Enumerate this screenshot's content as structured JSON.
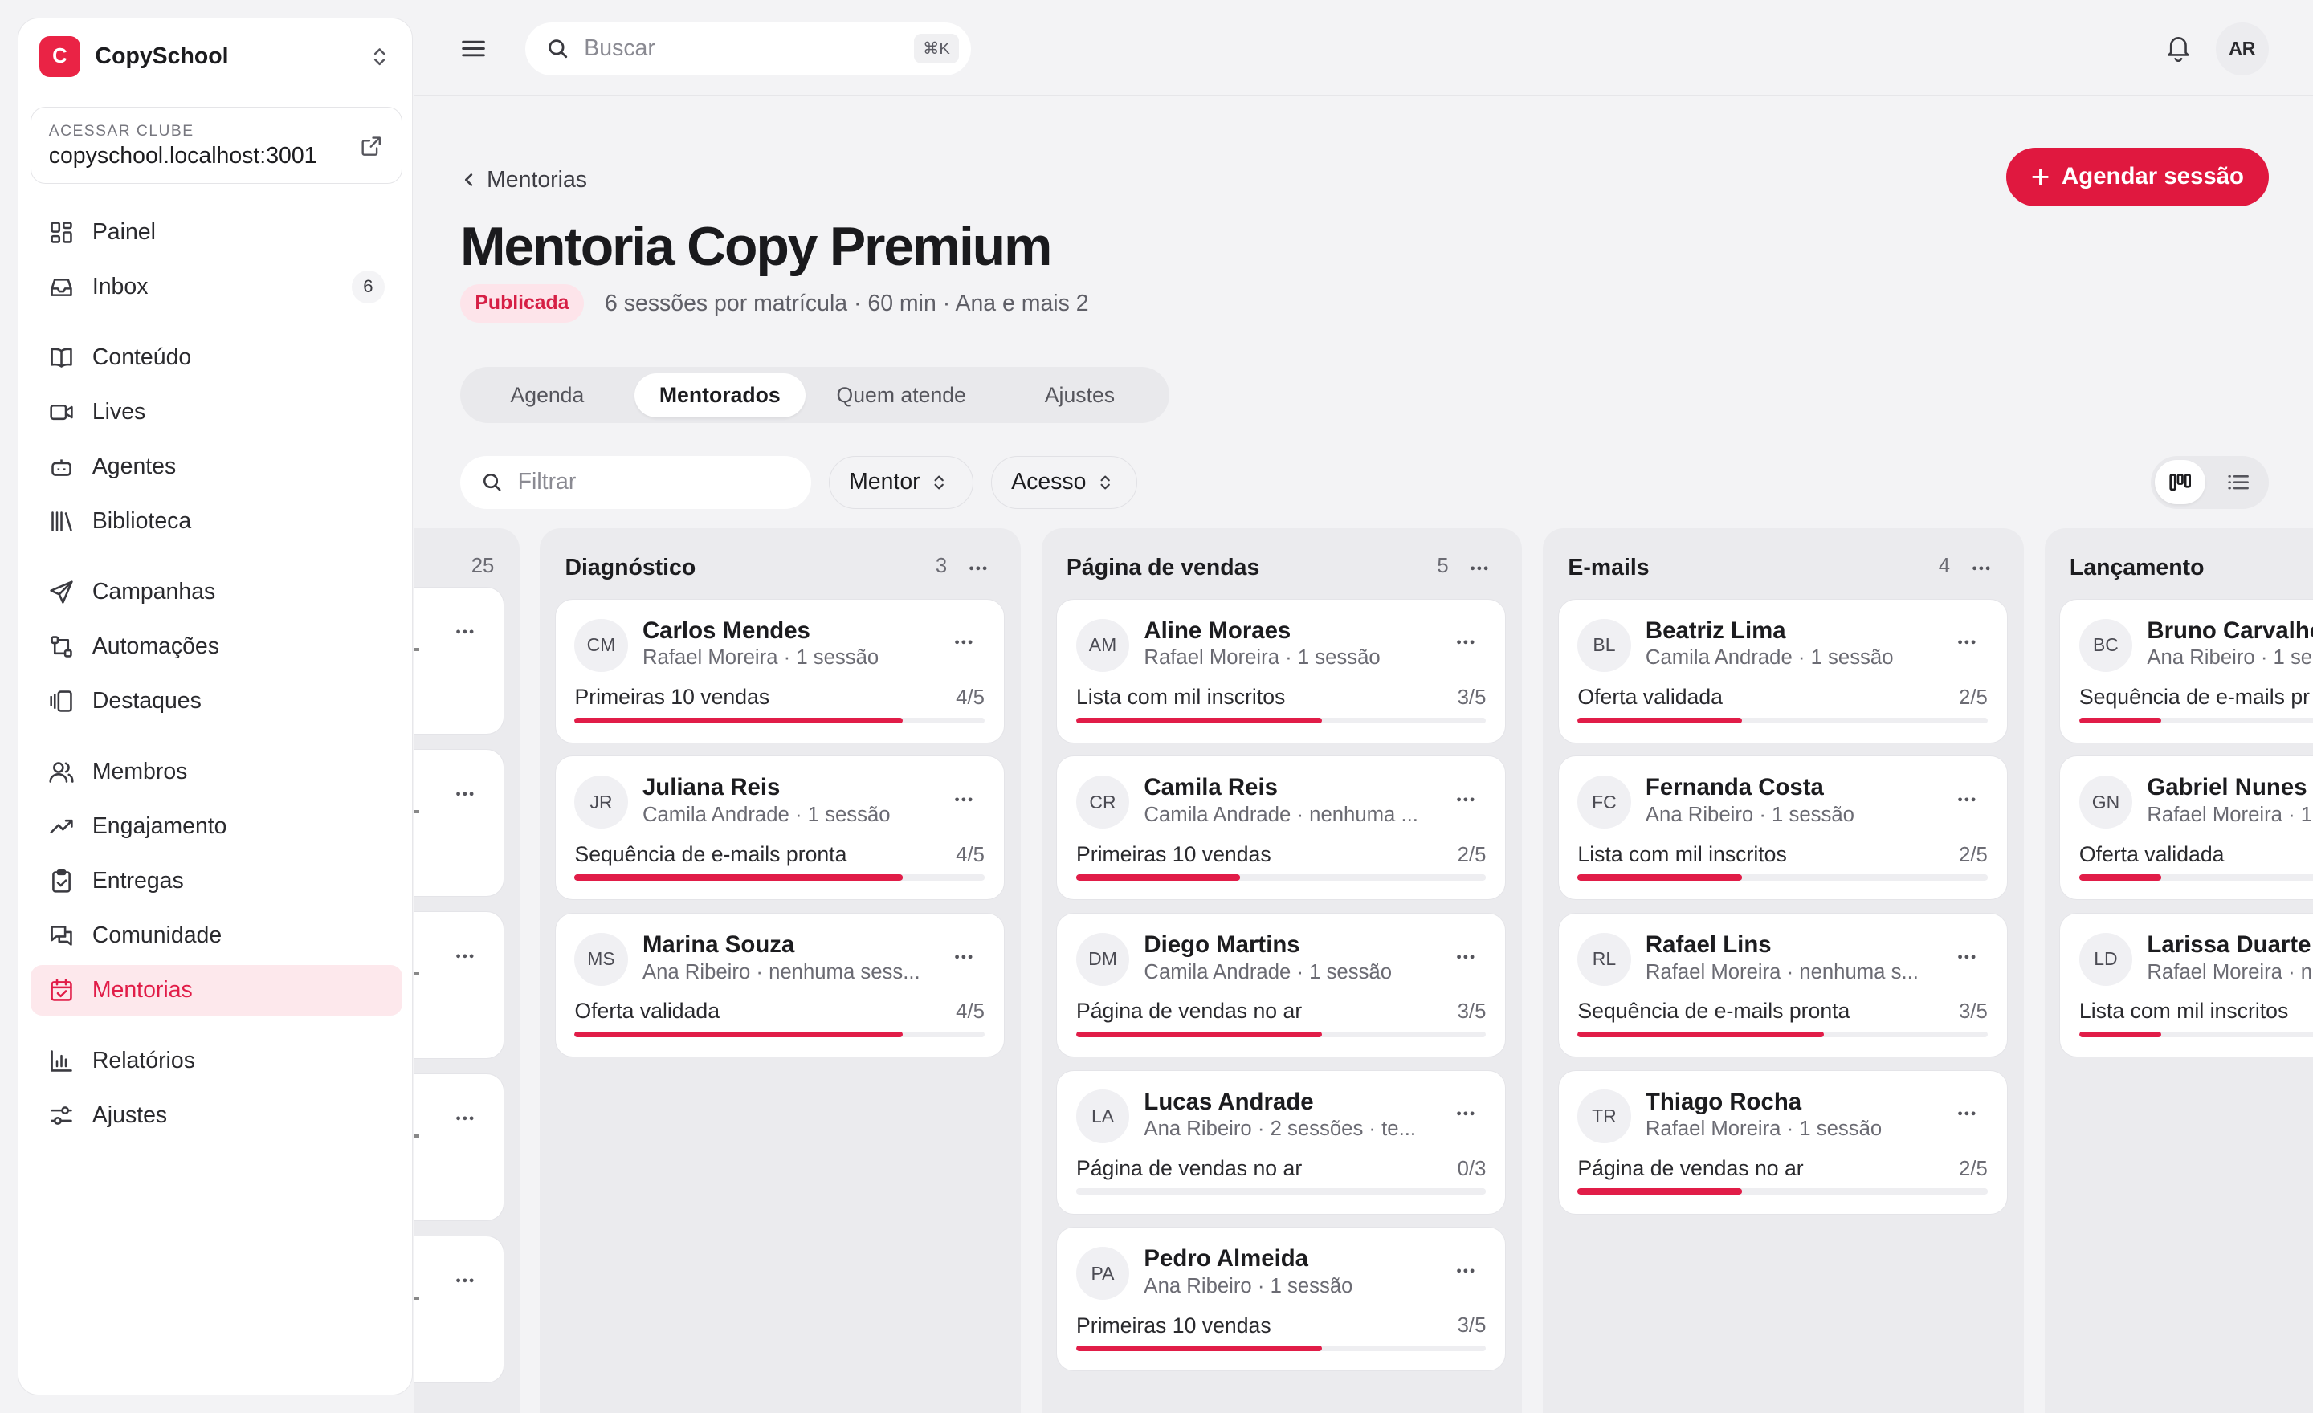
{
  "brand": {
    "logo_letter": "C",
    "name": "CopySchool"
  },
  "club": {
    "label": "ACESSAR CLUBE",
    "url": "copyschool.localhost:3001"
  },
  "nav": [
    {
      "label": "Painel",
      "icon": "grid-icon"
    },
    {
      "label": "Inbox",
      "icon": "inbox-icon",
      "count": "6"
    },
    {
      "label": "Conteúdo",
      "icon": "book-icon"
    },
    {
      "label": "Lives",
      "icon": "video-icon"
    },
    {
      "label": "Agentes",
      "icon": "bot-icon"
    },
    {
      "label": "Biblioteca",
      "icon": "library-icon"
    },
    {
      "label": "Campanhas",
      "icon": "send-icon"
    },
    {
      "label": "Automações",
      "icon": "workflow-icon"
    },
    {
      "label": "Destaques",
      "icon": "gallery-icon"
    },
    {
      "label": "Membros",
      "icon": "users-icon"
    },
    {
      "label": "Engajamento",
      "icon": "trending-icon"
    },
    {
      "label": "Entregas",
      "icon": "clipboard-check-icon"
    },
    {
      "label": "Comunidade",
      "icon": "chat-icon"
    },
    {
      "label": "Mentorias",
      "icon": "calendar-check-icon",
      "active": true
    },
    {
      "label": "Relatórios",
      "icon": "bar-chart-icon"
    },
    {
      "label": "Ajustes",
      "icon": "sliders-icon"
    }
  ],
  "topbar": {
    "search_placeholder": "Buscar",
    "shortcut": "⌘K",
    "user_initials": "AR"
  },
  "header": {
    "breadcrumb": "Mentorias",
    "title": "Mentoria Copy Premium",
    "status": "Publicada",
    "meta": "6 sessões por matrícula · 60 min · Ana e mais 2",
    "primary_action": "Agendar sessão"
  },
  "tabs": [
    {
      "label": "Agenda"
    },
    {
      "label": "Mentorados",
      "active": true
    },
    {
      "label": "Quem atende"
    },
    {
      "label": "Ajustes"
    }
  ],
  "filters": {
    "placeholder": "Filtrar",
    "mentor": "Mentor",
    "access": "Acesso"
  },
  "accent_color": "#e11d48",
  "board": {
    "first_column_count": "25",
    "columns": [
      {
        "title": "Diagnóstico",
        "count": "3",
        "cards": [
          {
            "initials": "CM",
            "name": "Carlos Mendes",
            "sub": "Rafael Moreira · 1 sessão",
            "goal": "Primeiras 10 vendas",
            "progress": "4/5",
            "ratio": 0.8
          },
          {
            "initials": "JR",
            "name": "Juliana Reis",
            "sub": "Camila Andrade · 1 sessão",
            "goal": "Sequência de e-mails pronta",
            "progress": "4/5",
            "ratio": 0.8
          },
          {
            "initials": "MS",
            "name": "Marina Souza",
            "sub": "Ana Ribeiro · nenhuma sess...",
            "goal": "Oferta validada",
            "progress": "4/5",
            "ratio": 0.8
          }
        ]
      },
      {
        "title": "Página de vendas",
        "count": "5",
        "cards": [
          {
            "initials": "AM",
            "name": "Aline Moraes",
            "sub": "Rafael Moreira · 1 sessão",
            "goal": "Lista com mil inscritos",
            "progress": "3/5",
            "ratio": 0.6
          },
          {
            "initials": "CR",
            "name": "Camila Reis",
            "sub": "Camila Andrade · nenhuma ...",
            "goal": "Primeiras 10 vendas",
            "progress": "2/5",
            "ratio": 0.4
          },
          {
            "initials": "DM",
            "name": "Diego Martins",
            "sub": "Camila Andrade · 1 sessão",
            "goal": "Página de vendas no ar",
            "progress": "3/5",
            "ratio": 0.6
          },
          {
            "initials": "LA",
            "name": "Lucas Andrade",
            "sub": "Ana Ribeiro · 2 sessões · te...",
            "goal": "Página de vendas no ar",
            "progress": "0/3",
            "ratio": 0
          },
          {
            "initials": "PA",
            "name": "Pedro Almeida",
            "sub": "Ana Ribeiro · 1 sessão",
            "goal": "Primeiras 10 vendas",
            "progress": "3/5",
            "ratio": 0.6
          }
        ]
      },
      {
        "title": "E-mails",
        "count": "4",
        "cards": [
          {
            "initials": "BL",
            "name": "Beatriz Lima",
            "sub": "Camila Andrade · 1 sessão",
            "goal": "Oferta validada",
            "progress": "2/5",
            "ratio": 0.4
          },
          {
            "initials": "FC",
            "name": "Fernanda Costa",
            "sub": "Ana Ribeiro · 1 sessão",
            "goal": "Lista com mil inscritos",
            "progress": "2/5",
            "ratio": 0.4
          },
          {
            "initials": "RL",
            "name": "Rafael Lins",
            "sub": "Rafael Moreira · nenhuma s...",
            "goal": "Sequência de e-mails pronta",
            "progress": "3/5",
            "ratio": 0.6
          },
          {
            "initials": "TR",
            "name": "Thiago Rocha",
            "sub": "Rafael Moreira · 1 sessão",
            "goal": "Página de vendas no ar",
            "progress": "2/5",
            "ratio": 0.4
          }
        ]
      },
      {
        "title": "Lançamento",
        "count": "",
        "cards": [
          {
            "initials": "BC",
            "name": "Bruno Carvalho",
            "sub": "Ana Ribeiro · 1 se",
            "goal": "Sequência de e-mails pr",
            "progress": "",
            "ratio": 0.2
          },
          {
            "initials": "GN",
            "name": "Gabriel Nunes",
            "sub": "Rafael Moreira · 1",
            "goal": "Oferta validada",
            "progress": "",
            "ratio": 0.2
          },
          {
            "initials": "LD",
            "name": "Larissa Duarte",
            "sub": "Rafael Moreira · n",
            "goal": "Lista com mil inscritos",
            "progress": "",
            "ratio": 0.2
          }
        ]
      }
    ]
  }
}
